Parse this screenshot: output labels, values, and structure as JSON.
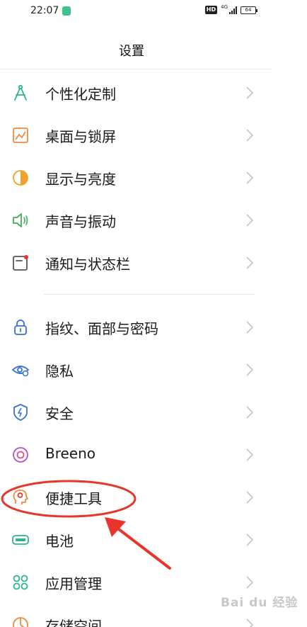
{
  "status_bar": {
    "time": "22:07",
    "hd": "HD",
    "network": "4G",
    "battery": "64"
  },
  "header": {
    "title": "设置"
  },
  "menu": {
    "items": [
      {
        "label": "个性化定制",
        "icon": "compass-icon",
        "color": "#2bb58f"
      },
      {
        "label": "桌面与锁屏",
        "icon": "wallpaper-icon",
        "color": "#f08a3e"
      },
      {
        "label": "显示与亮度",
        "icon": "brightness-icon",
        "color": "#f4a12b"
      },
      {
        "label": "声音与振动",
        "icon": "speaker-icon",
        "color": "#3fb05a"
      },
      {
        "label": "通知与状态栏",
        "icon": "notification-icon",
        "color": "#555555"
      },
      {
        "label": "指纹、面部与密码",
        "icon": "lock-icon",
        "color": "#3a6fd8"
      },
      {
        "label": "隐私",
        "icon": "privacy-eye-icon",
        "color": "#3a6fd8"
      },
      {
        "label": "安全",
        "icon": "shield-icon",
        "color": "#3a6fd8"
      },
      {
        "label": "Breeno",
        "icon": "breeno-icon",
        "color": "#b04fd8"
      },
      {
        "label": "便捷工具",
        "icon": "tools-icon",
        "color": "#f08a3e"
      },
      {
        "label": "电池",
        "icon": "battery-icon",
        "color": "#2bb58f"
      },
      {
        "label": "应用管理",
        "icon": "apps-icon",
        "color": "#2bb58f"
      },
      {
        "label": "存储空间",
        "icon": "storage-icon",
        "color": "#f08a3e"
      }
    ]
  },
  "colors": {
    "annotation": "#e8352b",
    "chevron": "#c4c4c4"
  },
  "watermark": "Bai du 经验"
}
